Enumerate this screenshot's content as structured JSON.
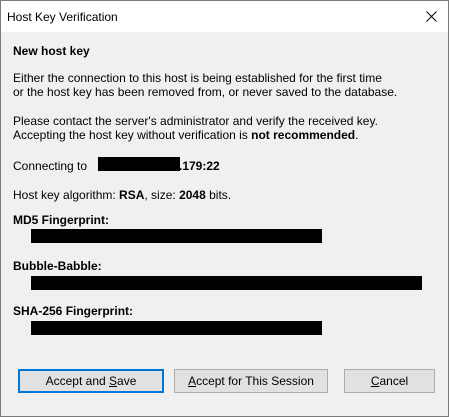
{
  "window": {
    "title": "Host Key Verification",
    "close_label": "×"
  },
  "content": {
    "heading": "New host key",
    "intro_line1": "Either the connection to this host is being established for the first time",
    "intro_line2": "or the host key has been removed from, or never saved to the database.",
    "contact_line1": "Please contact the server's administrator and verify the received key.",
    "contact_line2_prefix": "Accepting the host key without verification is ",
    "contact_line2_bold": "not recommended",
    "contact_line2_suffix": ".",
    "connecting_prefix": "Connecting to ",
    "connecting_suffix": ".179:22",
    "algorithm_prefix": "Host key algorithm: ",
    "algorithm_value": "RSA",
    "size_prefix": ", size: ",
    "size_value": "2048",
    "size_suffix": " bits.",
    "md5_label": "MD5 Fingerprint:",
    "bubble_label": "Bubble-Babble:",
    "sha_label": "SHA-256 Fingerprint:"
  },
  "buttons": {
    "accept_save_pre": "Accept and ",
    "accept_save_ul": "S",
    "accept_save_post": "ave",
    "accept_session_ul": "A",
    "accept_session_post": "ccept for This Session",
    "cancel_ul": "C",
    "cancel_post": "ancel"
  },
  "colors": {
    "dialog_bg": "#f0f0f0",
    "title_bg": "#ffffff",
    "default_button_border": "#0078d7",
    "button_bg": "#e1e1e1",
    "redaction": "#000000"
  }
}
